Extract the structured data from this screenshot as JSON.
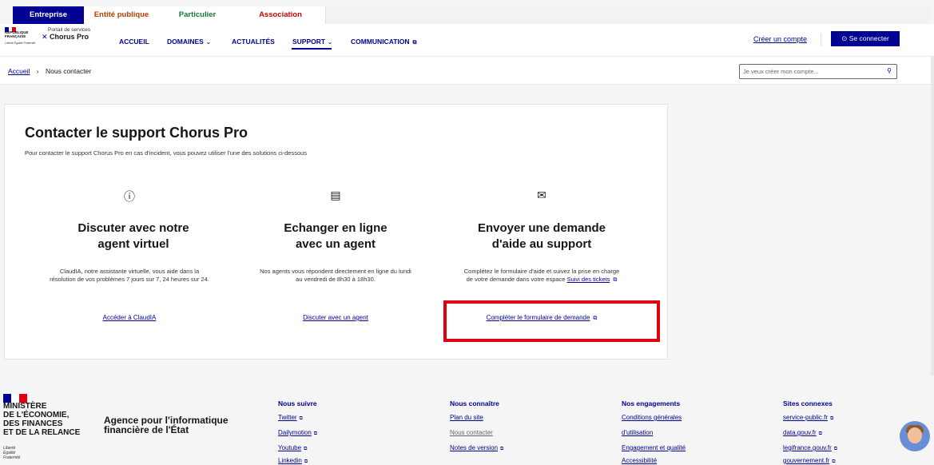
{
  "audience_tabs": [
    "Entreprise",
    "Entité publique",
    "Particulier",
    "Association"
  ],
  "logo": {
    "republique": "RÉPUBLIQUE FRANÇAISE",
    "motto": "Liberté Égalité Fraternité",
    "portal_subtitle": "Portail de services",
    "portal_name": "Chorus Pro"
  },
  "nav": {
    "items": [
      "ACCUEIL",
      "DOMAINES",
      "ACTUALITÉS",
      "SUPPORT",
      "COMMUNICATION"
    ],
    "active": "SUPPORT",
    "create_account": "Créer un compte",
    "login": "Se connecter"
  },
  "breadcrumb": {
    "home": "Accueil",
    "current": "Nous contacter"
  },
  "search": {
    "placeholder": "Je veux créer mon compte..."
  },
  "page": {
    "title": "Contacter le support Chorus Pro",
    "intro": "Pour contacter le support Chorus Pro en cas d'incident, vous pouvez utiliser l'une des solutions ci-dessous"
  },
  "options": [
    {
      "icon": "info-icon",
      "title_line1": "Discuter avec notre",
      "title_line2": "agent virtuel",
      "text": "ClaudIA, notre assistante virtuelle, vous aide dans la résolution de vos problèmes 7 jours sur 7, 24 heures sur 24.",
      "link": "Accéder à ClaudIA"
    },
    {
      "icon": "chat-icon",
      "title_line1": "Echanger en ligne",
      "title_line2": "avec un agent",
      "text": "Nos agents vous répondent directement en ligne du lundi au vendredi de 8h30 à 18h30.",
      "link": "Discuter avec un agent"
    },
    {
      "icon": "mail-icon",
      "title_line1": "Envoyer une demande",
      "title_line2": "d'aide au support",
      "text": "Complétez le formulaire d'aide et suivez la prise en charge de votre demande dans votre espace",
      "text_link": "Suivi des tickets",
      "link": "Compléter le formulaire de demande"
    }
  ],
  "footer": {
    "ministry": [
      "MINISTÈRE",
      "DE L'ÉCONOMIE,",
      "DES FINANCES",
      "ET DE LA RELANCE"
    ],
    "ministry_motto": [
      "Liberté",
      "Égalité",
      "Fraternité"
    ],
    "agency": [
      "Agence pour l'informatique",
      "financière de l'État"
    ],
    "columns": [
      {
        "title": "Nous suivre",
        "links": [
          "Twitter",
          "Dailymotion",
          "Youtube",
          "Linkedin"
        ]
      },
      {
        "title": "Nous connaître",
        "links": [
          "Plan du site",
          "Nous contacter",
          "Notes de version"
        ]
      },
      {
        "title": "Nos engagements",
        "links": [
          "Conditions générales",
          "d'utilisation",
          "Engagement et qualité",
          "Accessibilité"
        ]
      },
      {
        "title": "Sites connexes",
        "links": [
          "service-public.fr",
          "data.gouv.fr",
          "legifrance.gouv.fr",
          "gouvernement.fr"
        ]
      }
    ]
  },
  "colors": {
    "primary": "#000091",
    "highlight": "#e1000f"
  }
}
